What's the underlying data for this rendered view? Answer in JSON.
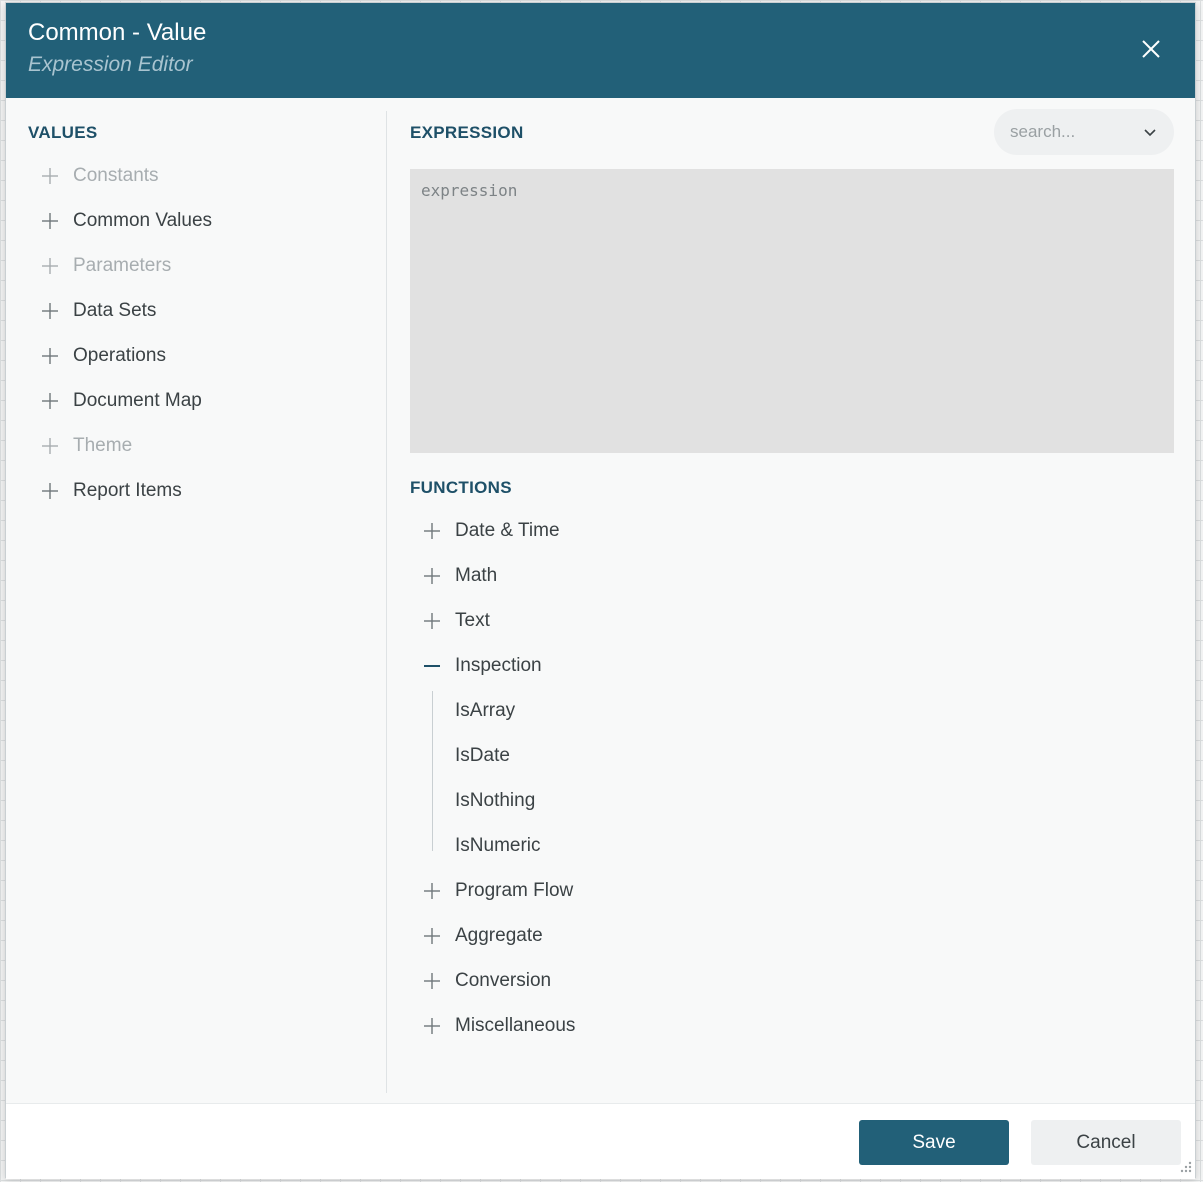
{
  "header": {
    "title": "Common - Value",
    "subtitle": "Expression Editor"
  },
  "values": {
    "label": "VALUES",
    "items": [
      {
        "label": "Constants",
        "disabled": true
      },
      {
        "label": "Common Values",
        "disabled": false
      },
      {
        "label": "Parameters",
        "disabled": true
      },
      {
        "label": "Data Sets",
        "disabled": false
      },
      {
        "label": "Operations",
        "disabled": false
      },
      {
        "label": "Document Map",
        "disabled": false
      },
      {
        "label": "Theme",
        "disabled": true
      },
      {
        "label": "Report Items",
        "disabled": false
      }
    ]
  },
  "expression": {
    "label": "EXPRESSION",
    "placeholder": "expression",
    "value": ""
  },
  "search": {
    "placeholder": "search..."
  },
  "functions": {
    "label": "FUNCTIONS",
    "items": [
      {
        "label": "Date & Time",
        "expanded": false
      },
      {
        "label": "Math",
        "expanded": false
      },
      {
        "label": "Text",
        "expanded": false
      },
      {
        "label": "Inspection",
        "expanded": true,
        "children": [
          "IsArray",
          "IsDate",
          "IsNothing",
          "IsNumeric"
        ]
      },
      {
        "label": "Program Flow",
        "expanded": false
      },
      {
        "label": "Aggregate",
        "expanded": false
      },
      {
        "label": "Conversion",
        "expanded": false
      },
      {
        "label": "Miscellaneous",
        "expanded": false
      }
    ]
  },
  "footer": {
    "save_label": "Save",
    "cancel_label": "Cancel"
  },
  "colors": {
    "header_bg": "#226078",
    "accent": "#1e5068",
    "disabled_text": "#a7adb0"
  }
}
